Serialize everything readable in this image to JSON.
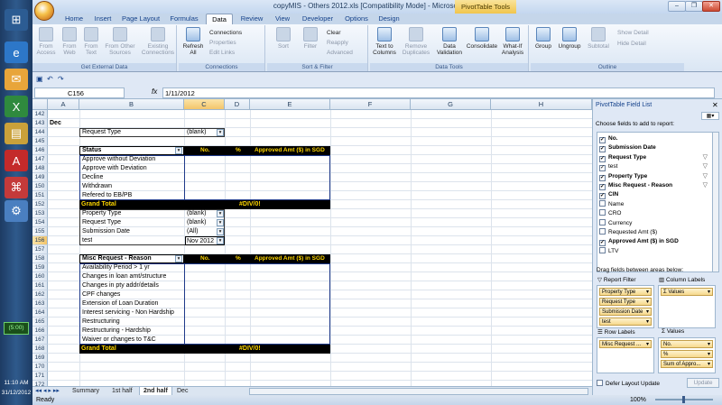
{
  "window": {
    "title": "copyMIS - Others 2012.xls  [Compatibility Mode] - Microsoft Excel",
    "tools_tab": "PivotTable Tools"
  },
  "ribbon": {
    "tabs": [
      "Home",
      "Insert",
      "Page Layout",
      "Formulas",
      "Data",
      "Review",
      "View",
      "Developer",
      "Options",
      "Design"
    ],
    "active_tab": "Data",
    "groups": {
      "get_external": "Get External Data",
      "connections": "Connections",
      "sort_filter": "Sort & Filter",
      "data_tools": "Data Tools",
      "outline": "Outline"
    },
    "buttons": {
      "from_access": "From Access",
      "from_web": "From Web",
      "from_text": "From Text",
      "from_other": "From Other Sources",
      "existing": "Existing Connections",
      "refresh": "Refresh All",
      "connections": "Connections",
      "properties": "Properties",
      "edit_links": "Edit Links",
      "sort": "Sort",
      "filter": "Filter",
      "clear": "Clear",
      "reapply": "Reapply",
      "advanced": "Advanced",
      "text_to_columns": "Text to Columns",
      "remove_duplicates": "Remove Duplicates",
      "data_validation": "Data Validation",
      "consolidate": "Consolidate",
      "whatif": "What-If Analysis",
      "group": "Group",
      "ungroup": "Ungroup",
      "subtotal": "Subtotal",
      "show_detail": "Show Detail",
      "hide_detail": "Hide Detail"
    }
  },
  "formula_bar": {
    "namebox": "C156",
    "fx": "fx",
    "content": "1/11/2012"
  },
  "columns": [
    "A",
    "B",
    "C",
    "D",
    "E",
    "F",
    "G",
    "H"
  ],
  "rows": [
    "142",
    "143",
    "144",
    "145",
    "146",
    "147",
    "148",
    "149",
    "150",
    "151",
    "152",
    "153",
    "154",
    "155",
    "156",
    "157",
    "158",
    "159",
    "160",
    "161",
    "162",
    "163",
    "164",
    "165",
    "166",
    "167",
    "168",
    "169",
    "170",
    "171",
    "172"
  ],
  "cells": {
    "dec": "Dec",
    "request_type_label": "Request Type",
    "request_type_value": "(blank)",
    "status_header": "Status",
    "col_no": "No.",
    "col_pct": "%",
    "col_amt": "Approved Amt ($) in SGD",
    "status_items": [
      "Approve without Deviation",
      "Approve with Deviation",
      "Decline",
      "Withdrawn",
      "Refered to EB/PB"
    ],
    "grand_total": "Grand Total",
    "div0": "#DIV/0!",
    "filters": [
      {
        "label": "Property Type",
        "value": "(blank)"
      },
      {
        "label": "Request Type",
        "value": "(blank)"
      },
      {
        "label": "Submission Date",
        "value": "(All)"
      },
      {
        "label": "test",
        "value": "Nov 2012"
      }
    ],
    "misc_header": "Misc Request - Reason",
    "misc_items": [
      "Availability Period > 1 yr",
      "Changes in loan amt/structure",
      "Changes in pty addr/details",
      "CPF changes",
      "Extension of Loan Duration",
      "Interest servicing - Non Hardship",
      "Restructuring",
      "Restructuring - Hardship",
      "Waiver or changes to T&C"
    ]
  },
  "sheets": [
    "Summary",
    "1st half",
    "2nd half",
    "Dec"
  ],
  "active_sheet": "2nd half",
  "status": {
    "ready": "Ready",
    "zoom": "100%"
  },
  "field_list": {
    "title": "PivotTable Field List",
    "subtitle": "Choose fields to add to report:",
    "fields": [
      {
        "name": "No.",
        "checked": true,
        "bold": true,
        "filter": false
      },
      {
        "name": "Submission Date",
        "checked": true,
        "bold": true,
        "filter": false
      },
      {
        "name": "Request Type",
        "checked": true,
        "bold": true,
        "filter": true
      },
      {
        "name": "test",
        "checked": true,
        "bold": false,
        "filter": true
      },
      {
        "name": "Property Type",
        "checked": true,
        "bold": true,
        "filter": true
      },
      {
        "name": "Misc Request - Reason",
        "checked": true,
        "bold": true,
        "filter": true
      },
      {
        "name": "CIN",
        "checked": true,
        "bold": true,
        "filter": false
      },
      {
        "name": "Name",
        "checked": false,
        "bold": false,
        "filter": false
      },
      {
        "name": "CRO",
        "checked": false,
        "bold": false,
        "filter": false
      },
      {
        "name": "Currency",
        "checked": false,
        "bold": false,
        "filter": false
      },
      {
        "name": "Requested Amt ($)",
        "checked": false,
        "bold": false,
        "filter": false
      },
      {
        "name": "Approved Amt ($) in SGD",
        "checked": true,
        "bold": true,
        "filter": false
      },
      {
        "name": "LTV",
        "checked": false,
        "bold": false,
        "filter": false
      }
    ],
    "drag_label": "Drag fields between areas below:",
    "report_filter_label": "Report Filter",
    "column_labels_label": "Column Labels",
    "row_labels_label": "Row Labels",
    "values_label": "Values",
    "report_filter": [
      "Property Type",
      "Request Type",
      "Submission Date",
      "test"
    ],
    "column_labels": [
      "Σ Values"
    ],
    "row_labels": [
      "Misc Request ..."
    ],
    "values": [
      "No.",
      "%",
      "Sum of Appro..."
    ],
    "defer_label": "Defer Layout Update",
    "update_label": "Update"
  },
  "taskbar": {
    "battery": "(5:00)",
    "time": "11:10 AM",
    "date": "31/12/2012"
  }
}
